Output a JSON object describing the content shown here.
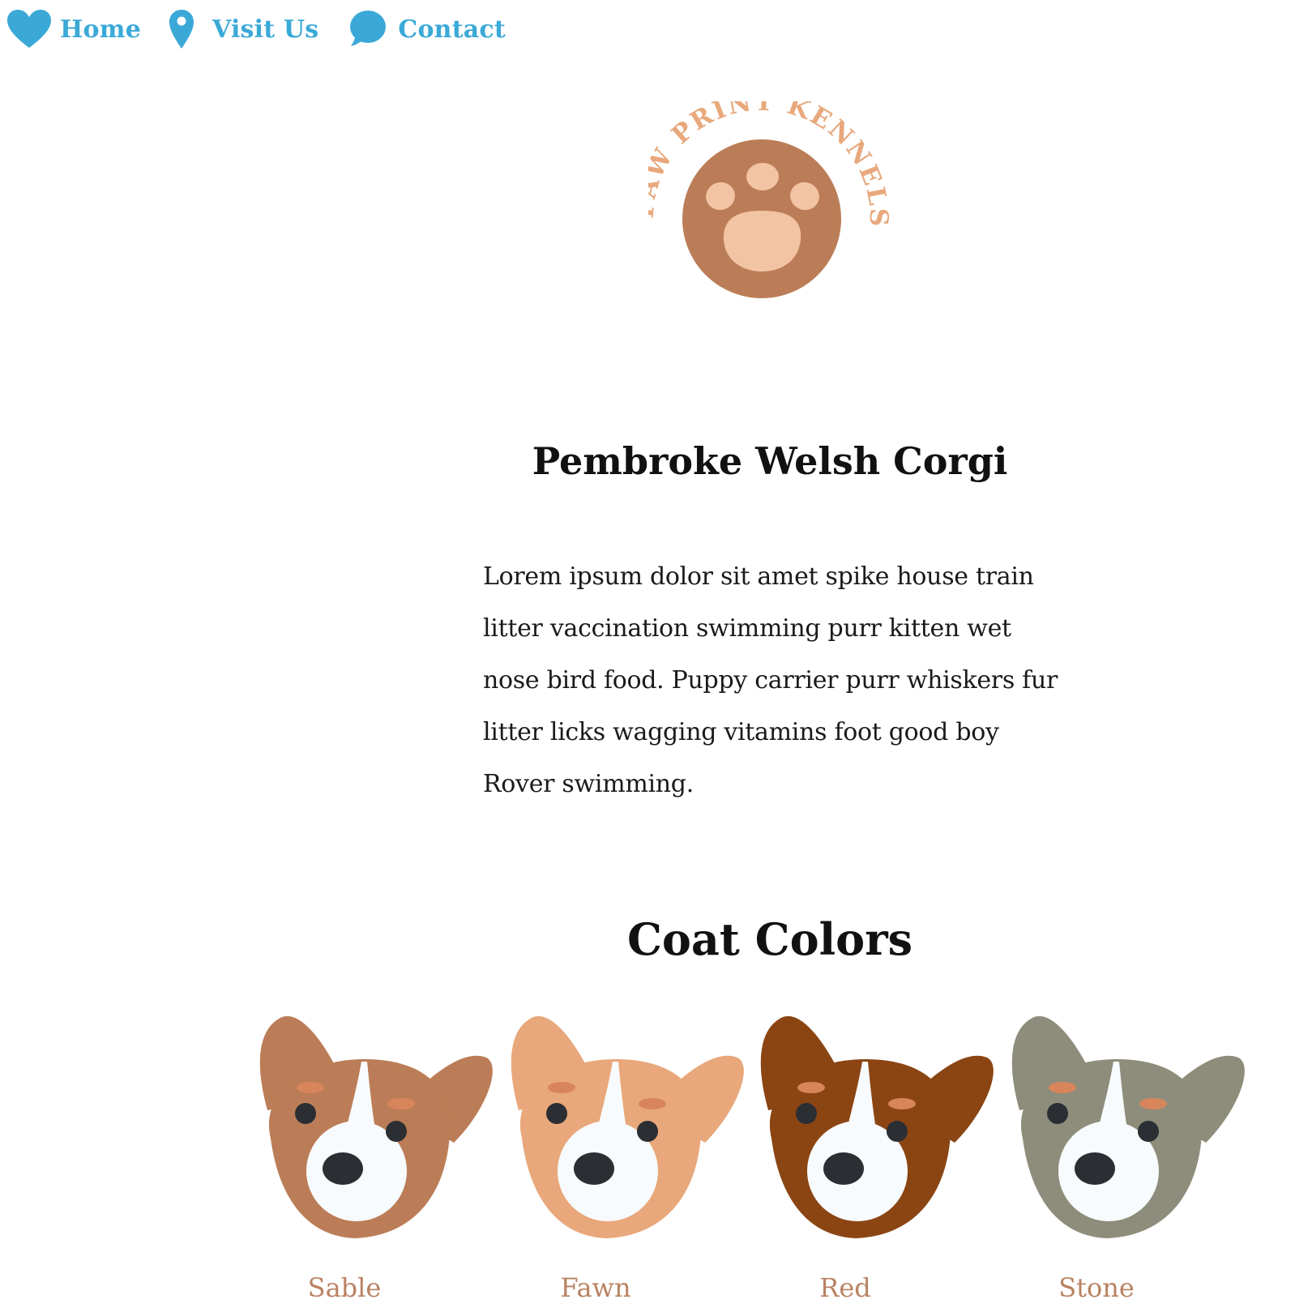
{
  "nav": {
    "items": [
      {
        "label": "Home",
        "icon": "heart-icon"
      },
      {
        "label": "Visit Us",
        "icon": "map-pin-icon"
      },
      {
        "label": "Contact",
        "icon": "speech-bubble-icon"
      }
    ]
  },
  "logo": {
    "text": "PAW PRINT KENNELS",
    "icon": "paw-print-icon"
  },
  "breed": {
    "title": "Pembroke Welsh Corgi",
    "description": "Lorem ipsum dolor sit amet spike house train litter vaccination swimming purr kitten wet nose bird food. Puppy carrier purr whiskers fur litter licks wagging vitamins foot good boy Rover swimming."
  },
  "coat_colors": {
    "title": "Coat Colors",
    "items": [
      {
        "label": "Sable",
        "color": "#bb7d57"
      },
      {
        "label": "Fawn",
        "color": "#e8a87c"
      },
      {
        "label": "Red",
        "color": "#8b4513"
      },
      {
        "label": "Stone",
        "color": "#8e8d7b"
      }
    ]
  },
  "colors": {
    "nav_accent": "#3ba9d7",
    "logo_text": "#e8a87c",
    "logo_circle": "#bb7d57",
    "logo_paw": "#f3c4a3",
    "caption": "#b98262",
    "eyebrow": "#d9855c",
    "eye": "#2b2e33",
    "muzzle": "#f8fbfd"
  }
}
